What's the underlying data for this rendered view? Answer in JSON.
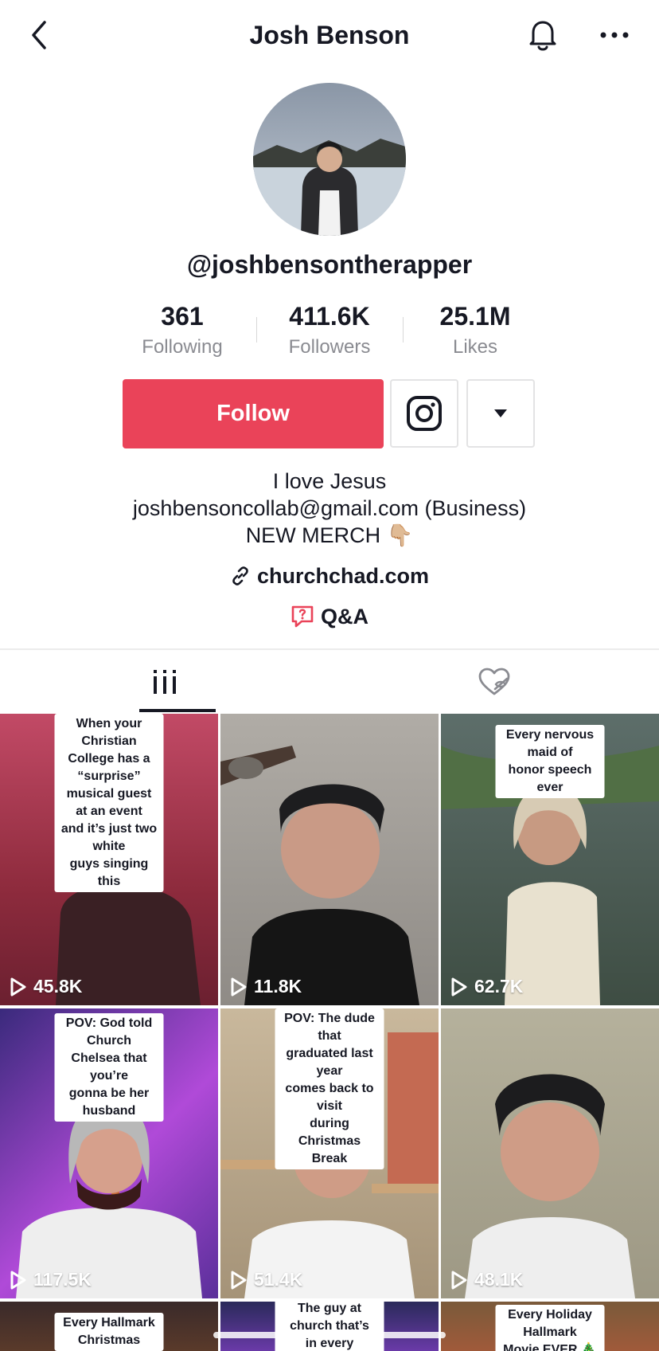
{
  "header": {
    "title": "Josh Benson",
    "back_icon": "chevron-left-icon",
    "bell_icon": "bell-icon",
    "more_icon": "more-icon"
  },
  "profile": {
    "handle": "@joshbensontherapper",
    "stats": [
      {
        "value": "361",
        "label": "Following"
      },
      {
        "value": "411.6K",
        "label": "Followers"
      },
      {
        "value": "25.1M",
        "label": "Likes"
      }
    ],
    "follow_label": "Follow",
    "bio": [
      "I love Jesus",
      "joshbensoncollab@gmail.com (Business)",
      "NEW MERCH 👇🏼"
    ],
    "link": "churchchad.com",
    "qa": "Q&A"
  },
  "colors": {
    "accent": "#ea4359",
    "text": "#161823",
    "muted": "#8a8b91"
  },
  "videos": [
    {
      "caption": "When your Christian\nCollege has a “surprise”\nmusical guest at an event\nand it’s just two white\nguys singing this",
      "views": "45.8K"
    },
    {
      "caption": "",
      "views": "11.8K"
    },
    {
      "caption": "Every nervous maid of\nhonor speech ever",
      "views": "62.7K"
    },
    {
      "caption": "POV: God told Church\nChelsea that you’re\ngonna be her husband",
      "views": "117.5K"
    },
    {
      "caption": "POV: The dude that\ngraduated last year\ncomes back to visit\nduring Christmas Break",
      "views": "51.4K"
    },
    {
      "caption": "",
      "views": "48.1K"
    },
    {
      "caption": "Every Hallmark Christmas",
      "views": ""
    },
    {
      "caption": "The guy at church that’s\nin every newlywed",
      "views": ""
    },
    {
      "caption": "Every Holiday Hallmark\nMovie EVER 🎄",
      "views": ""
    }
  ]
}
